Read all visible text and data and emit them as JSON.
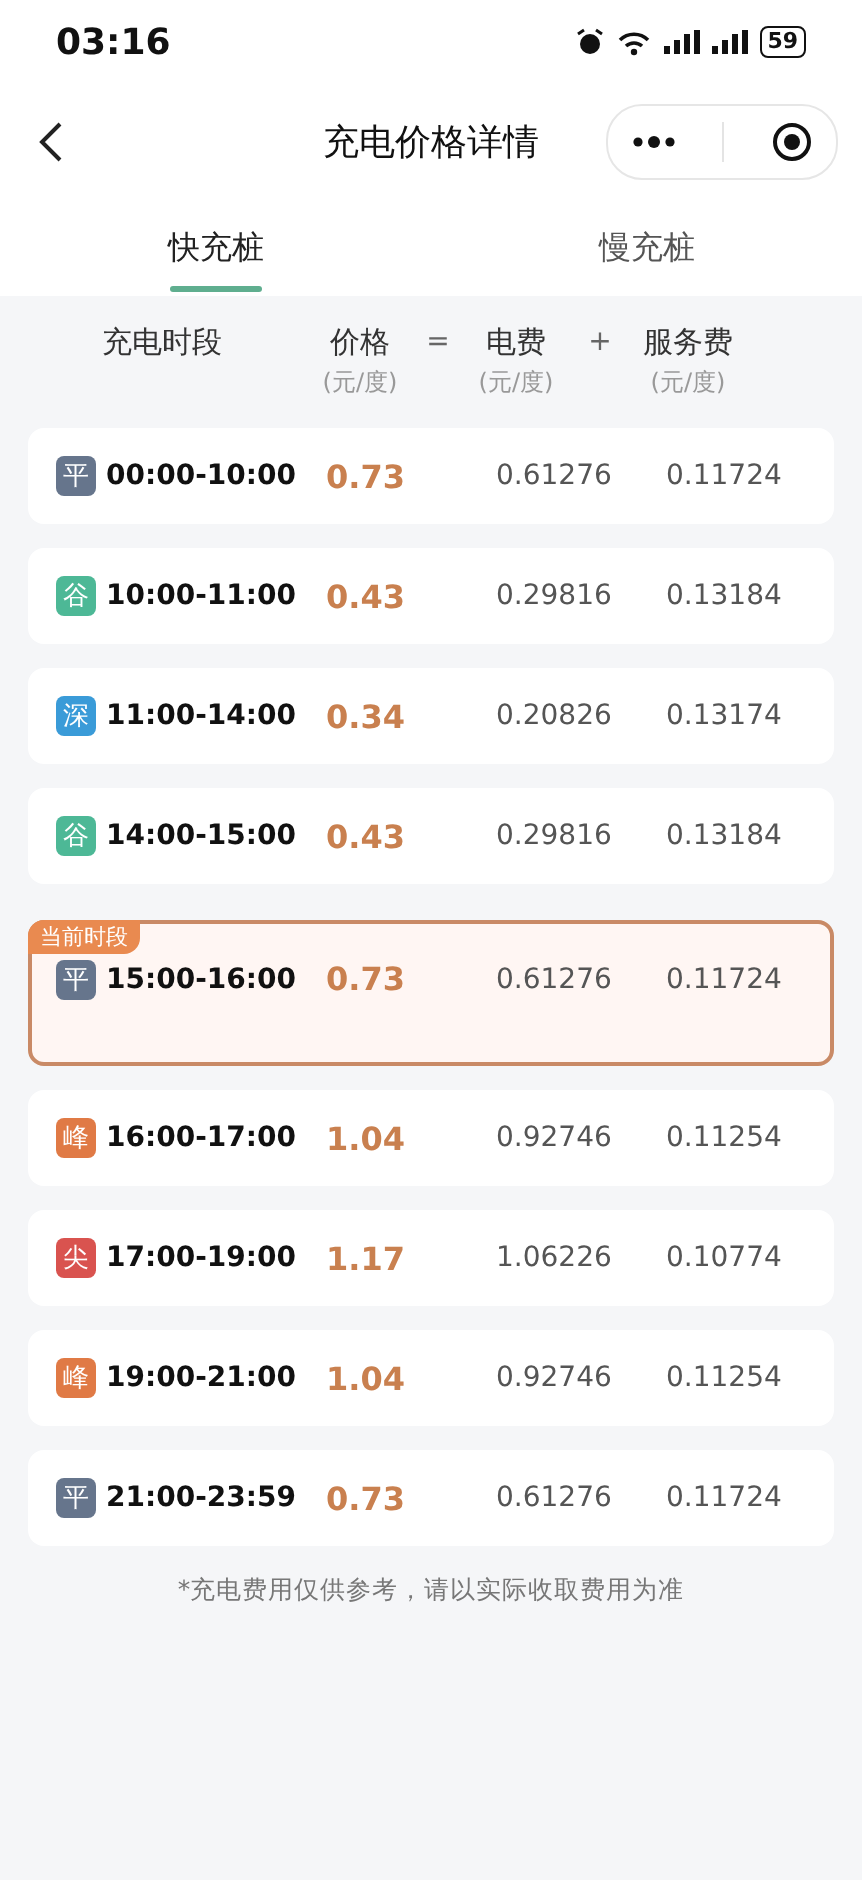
{
  "status_bar": {
    "time": "03:16",
    "battery": "59"
  },
  "nav": {
    "title": "充电价格详情"
  },
  "tabs": [
    {
      "label": "快充桩",
      "selected": true
    },
    {
      "label": "慢充桩",
      "selected": false
    }
  ],
  "header": {
    "period": "充电时段",
    "price": "价格",
    "price_unit": "(元/度)",
    "equals": "=",
    "electric": "电费",
    "electric_unit": "(元/度)",
    "plus": "+",
    "service": "服务费",
    "service_unit": "(元/度)"
  },
  "current_badge": "当前时段",
  "rows": [
    {
      "tier": "平",
      "color": "#66758c",
      "time": "00:00-10:00",
      "price": "0.73",
      "electric": "0.61276",
      "service": "0.11724",
      "current": false
    },
    {
      "tier": "谷",
      "color": "#4db896",
      "time": "10:00-11:00",
      "price": "0.43",
      "electric": "0.29816",
      "service": "0.13184",
      "current": false
    },
    {
      "tier": "深",
      "color": "#3a9bd8",
      "time": "11:00-14:00",
      "price": "0.34",
      "electric": "0.20826",
      "service": "0.13174",
      "current": false
    },
    {
      "tier": "谷",
      "color": "#4db896",
      "time": "14:00-15:00",
      "price": "0.43",
      "electric": "0.29816",
      "service": "0.13184",
      "current": false
    },
    {
      "tier": "平",
      "color": "#66758c",
      "time": "15:00-16:00",
      "price": "0.73",
      "electric": "0.61276",
      "service": "0.11724",
      "current": true
    },
    {
      "tier": "峰",
      "color": "#e07a45",
      "time": "16:00-17:00",
      "price": "1.04",
      "electric": "0.92746",
      "service": "0.11254",
      "current": false
    },
    {
      "tier": "尖",
      "color": "#d9534f",
      "time": "17:00-19:00",
      "price": "1.17",
      "electric": "1.06226",
      "service": "0.10774",
      "current": false
    },
    {
      "tier": "峰",
      "color": "#e07a45",
      "time": "19:00-21:00",
      "price": "1.04",
      "electric": "0.92746",
      "service": "0.11254",
      "current": false
    },
    {
      "tier": "平",
      "color": "#66758c",
      "time": "21:00-23:59",
      "price": "0.73",
      "electric": "0.61276",
      "service": "0.11724",
      "current": false
    }
  ],
  "footnote": "*充电费用仅供参考，请以实际收取费用为准"
}
